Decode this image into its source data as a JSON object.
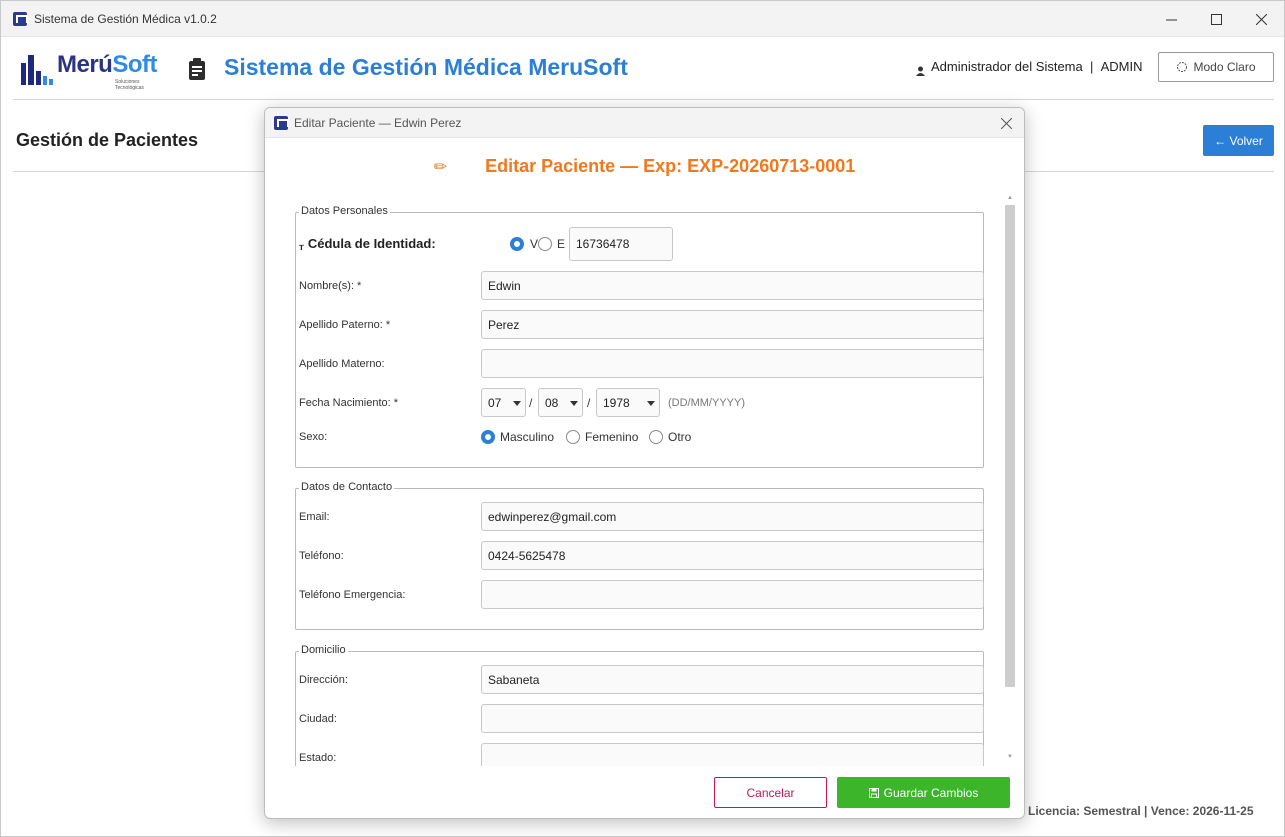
{
  "window": {
    "title": "Sistema de Gestión Médica v1.0.2",
    "minimize_icon": "minimize-icon",
    "maximize_icon": "maximize-icon",
    "close_icon": "close-icon"
  },
  "header": {
    "logo_text_1": "Merú",
    "logo_text_2": "Soft",
    "logo_subtitle": "Soluciones Tecnológicas",
    "title": "Sistema de Gestión Médica MeruSoft",
    "user_name": "Administrador del Sistema",
    "user_separator": "|",
    "user_role": "ADMIN",
    "mode_button": "Modo Claro"
  },
  "page": {
    "section_title": "Gestión de Pacientes",
    "back_button": "← Volver",
    "license": "Licencia: Semestral  |  Vence: 2026-11-25"
  },
  "dialog": {
    "title": "Editar Paciente — Edwin Perez",
    "heading_icon": "✏",
    "heading": "Editar Paciente  —  Exp: EXP-20260713-0001",
    "personal": {
      "legend": "Datos Personales",
      "cedula_label": "Cédula de Identidad:",
      "cedula_prefix_v": "V",
      "cedula_prefix_e": "E",
      "cedula_selected": "V",
      "cedula_value": "16736478",
      "nombre_label": "Nombre(s): *",
      "nombre_value": "Edwin",
      "apellido_paterno_label": "Apellido Paterno: *",
      "apellido_paterno_value": "Perez",
      "apellido_materno_label": "Apellido Materno:",
      "apellido_materno_value": "",
      "fecha_label": "Fecha Nacimiento: *",
      "fecha_dia": "07",
      "fecha_mes": "08",
      "fecha_anio": "1978",
      "fecha_sep": "/",
      "fecha_hint": "(DD/MM/YYYY)",
      "sexo_label": "Sexo:",
      "sexo_options": [
        "Masculino",
        "Femenino",
        "Otro"
      ],
      "sexo_selected": "Masculino"
    },
    "contacto": {
      "legend": "Datos de Contacto",
      "email_label": "Email:",
      "email_value": "edwinperez@gmail.com",
      "telefono_label": "Teléfono:",
      "telefono_value": "0424-5625478",
      "telefono_emergencia_label": "Teléfono Emergencia:",
      "telefono_emergencia_value": ""
    },
    "domicilio": {
      "legend": "Domicilio",
      "direccion_label": "Dirección:",
      "direccion_value": "Sabaneta",
      "ciudad_label": "Ciudad:",
      "ciudad_value": "",
      "estado_label": "Estado:",
      "estado_value": ""
    },
    "cancel_button": "Cancelar",
    "save_button": "Guardar Cambios"
  },
  "colors": {
    "accent_blue": "#2b7fd6",
    "heading_orange": "#f0791e",
    "save_green": "#3cb52a",
    "cancel_red": "#c2185b"
  }
}
